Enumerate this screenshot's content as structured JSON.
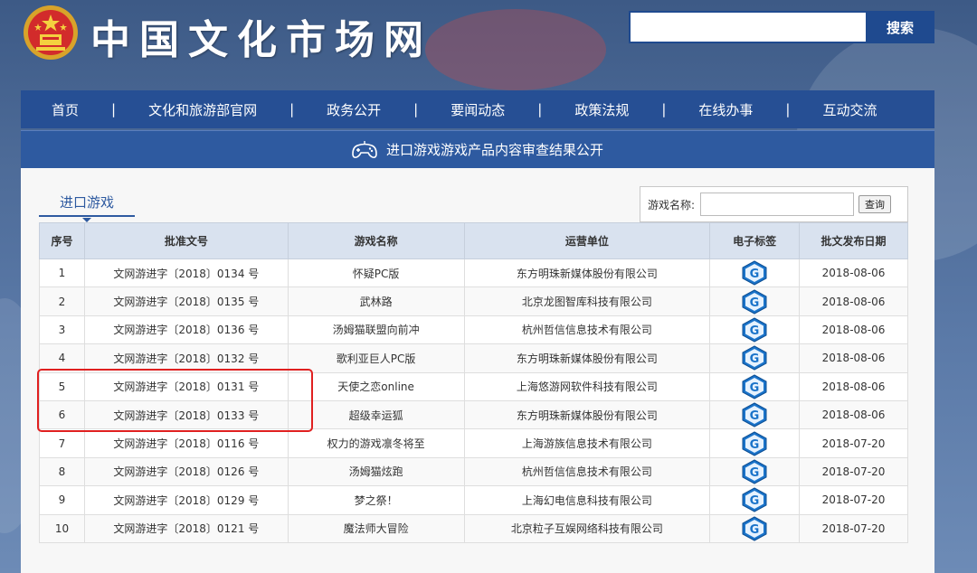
{
  "site": {
    "title": "中国文化市场网"
  },
  "search": {
    "placeholder": "",
    "button_label": "搜索"
  },
  "nav": {
    "items": [
      {
        "label": "首页"
      },
      {
        "label": "文化和旅游部官网"
      },
      {
        "label": "政务公开"
      },
      {
        "label": "要闻动态"
      },
      {
        "label": "政策法规"
      },
      {
        "label": "在线办事"
      },
      {
        "label": "互动交流"
      }
    ],
    "separator": "|"
  },
  "banner": {
    "title": "进口游戏游戏产品内容审查结果公开",
    "icon": "gamepad-icon"
  },
  "tab": {
    "label": "进口游戏"
  },
  "filter": {
    "label": "游戏名称:",
    "value": "",
    "button_label": "查询"
  },
  "table": {
    "headers": [
      "序号",
      "批准文号",
      "游戏名称",
      "运营单位",
      "电子标签",
      "批文发布日期"
    ],
    "label_icon": "g-label-icon",
    "rows": [
      {
        "no": "1",
        "approval": "文网游进字〔2018〕0134 号",
        "name": "怀疑PC版",
        "operator": "东方明珠新媒体股份有限公司",
        "date": "2018-08-06"
      },
      {
        "no": "2",
        "approval": "文网游进字〔2018〕0135 号",
        "name": "武林路",
        "operator": "北京龙图智库科技有限公司",
        "date": "2018-08-06"
      },
      {
        "no": "3",
        "approval": "文网游进字〔2018〕0136 号",
        "name": "汤姆猫联盟向前冲",
        "operator": "杭州哲信信息技术有限公司",
        "date": "2018-08-06"
      },
      {
        "no": "4",
        "approval": "文网游进字〔2018〕0132 号",
        "name": "歌利亚巨人PC版",
        "operator": "东方明珠新媒体股份有限公司",
        "date": "2018-08-06"
      },
      {
        "no": "5",
        "approval": "文网游进字〔2018〕0131 号",
        "name": "天使之恋online",
        "operator": "上海悠游网软件科技有限公司",
        "date": "2018-08-06"
      },
      {
        "no": "6",
        "approval": "文网游进字〔2018〕0133 号",
        "name": "超级幸运狐",
        "operator": "东方明珠新媒体股份有限公司",
        "date": "2018-08-06"
      },
      {
        "no": "7",
        "approval": "文网游进字〔2018〕0116 号",
        "name": "权力的游戏凛冬将至",
        "operator": "上海游族信息技术有限公司",
        "date": "2018-07-20"
      },
      {
        "no": "8",
        "approval": "文网游进字〔2018〕0126 号",
        "name": "汤姆猫炫跑",
        "operator": "杭州哲信信息技术有限公司",
        "date": "2018-07-20"
      },
      {
        "no": "9",
        "approval": "文网游进字〔2018〕0129 号",
        "name": "梦之祭！",
        "operator": "上海幻电信息科技有限公司",
        "date": "2018-07-20"
      },
      {
        "no": "10",
        "approval": "文网游进字〔2018〕0121 号",
        "name": "魔法师大冒险",
        "operator": "北京粒子互娱网络科技有限公司",
        "date": "2018-07-20"
      }
    ]
  },
  "colors": {
    "nav": "#264f94",
    "banner": "#2e5aa0",
    "highlight": "#e02020",
    "accent": "#1f4a8f"
  }
}
